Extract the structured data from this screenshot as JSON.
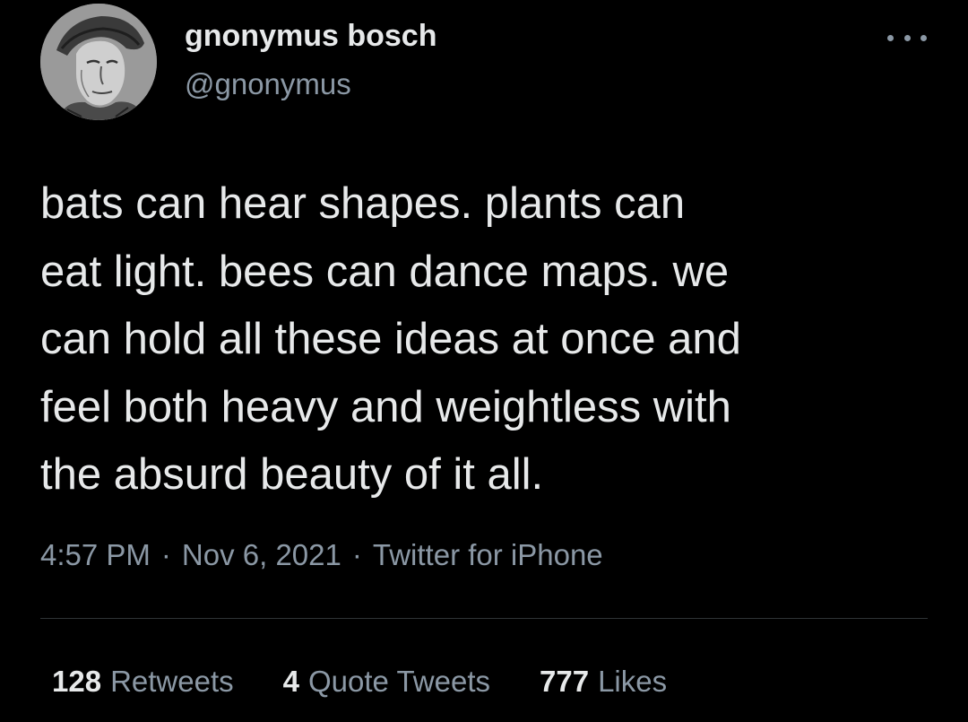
{
  "tweet": {
    "author": {
      "display_name": "gnonymus bosch",
      "handle": "@gnonymus",
      "avatar_icon": "portrait-engraving"
    },
    "more_icon": "ellipsis-icon",
    "text_lines": [
      "bats can hear shapes. plants can",
      "eat light. bees can dance maps. we",
      "can hold all these ideas at once and",
      "feel both heavy and weightless with",
      "the absurd beauty of it all."
    ],
    "time": "4:57 PM",
    "date": "Nov 6, 2021",
    "source": "Twitter for iPhone",
    "separator": "·",
    "stats": {
      "retweets": {
        "count": "128",
        "label": "Retweets"
      },
      "quotes": {
        "count": "4",
        "label": "Quote Tweets"
      },
      "likes": {
        "count": "777",
        "label": "Likes"
      }
    }
  },
  "colors": {
    "background": "#000000",
    "primary_text": "#e7e9ea",
    "secondary_text": "#8b98a5",
    "divider": "#2f3336"
  }
}
